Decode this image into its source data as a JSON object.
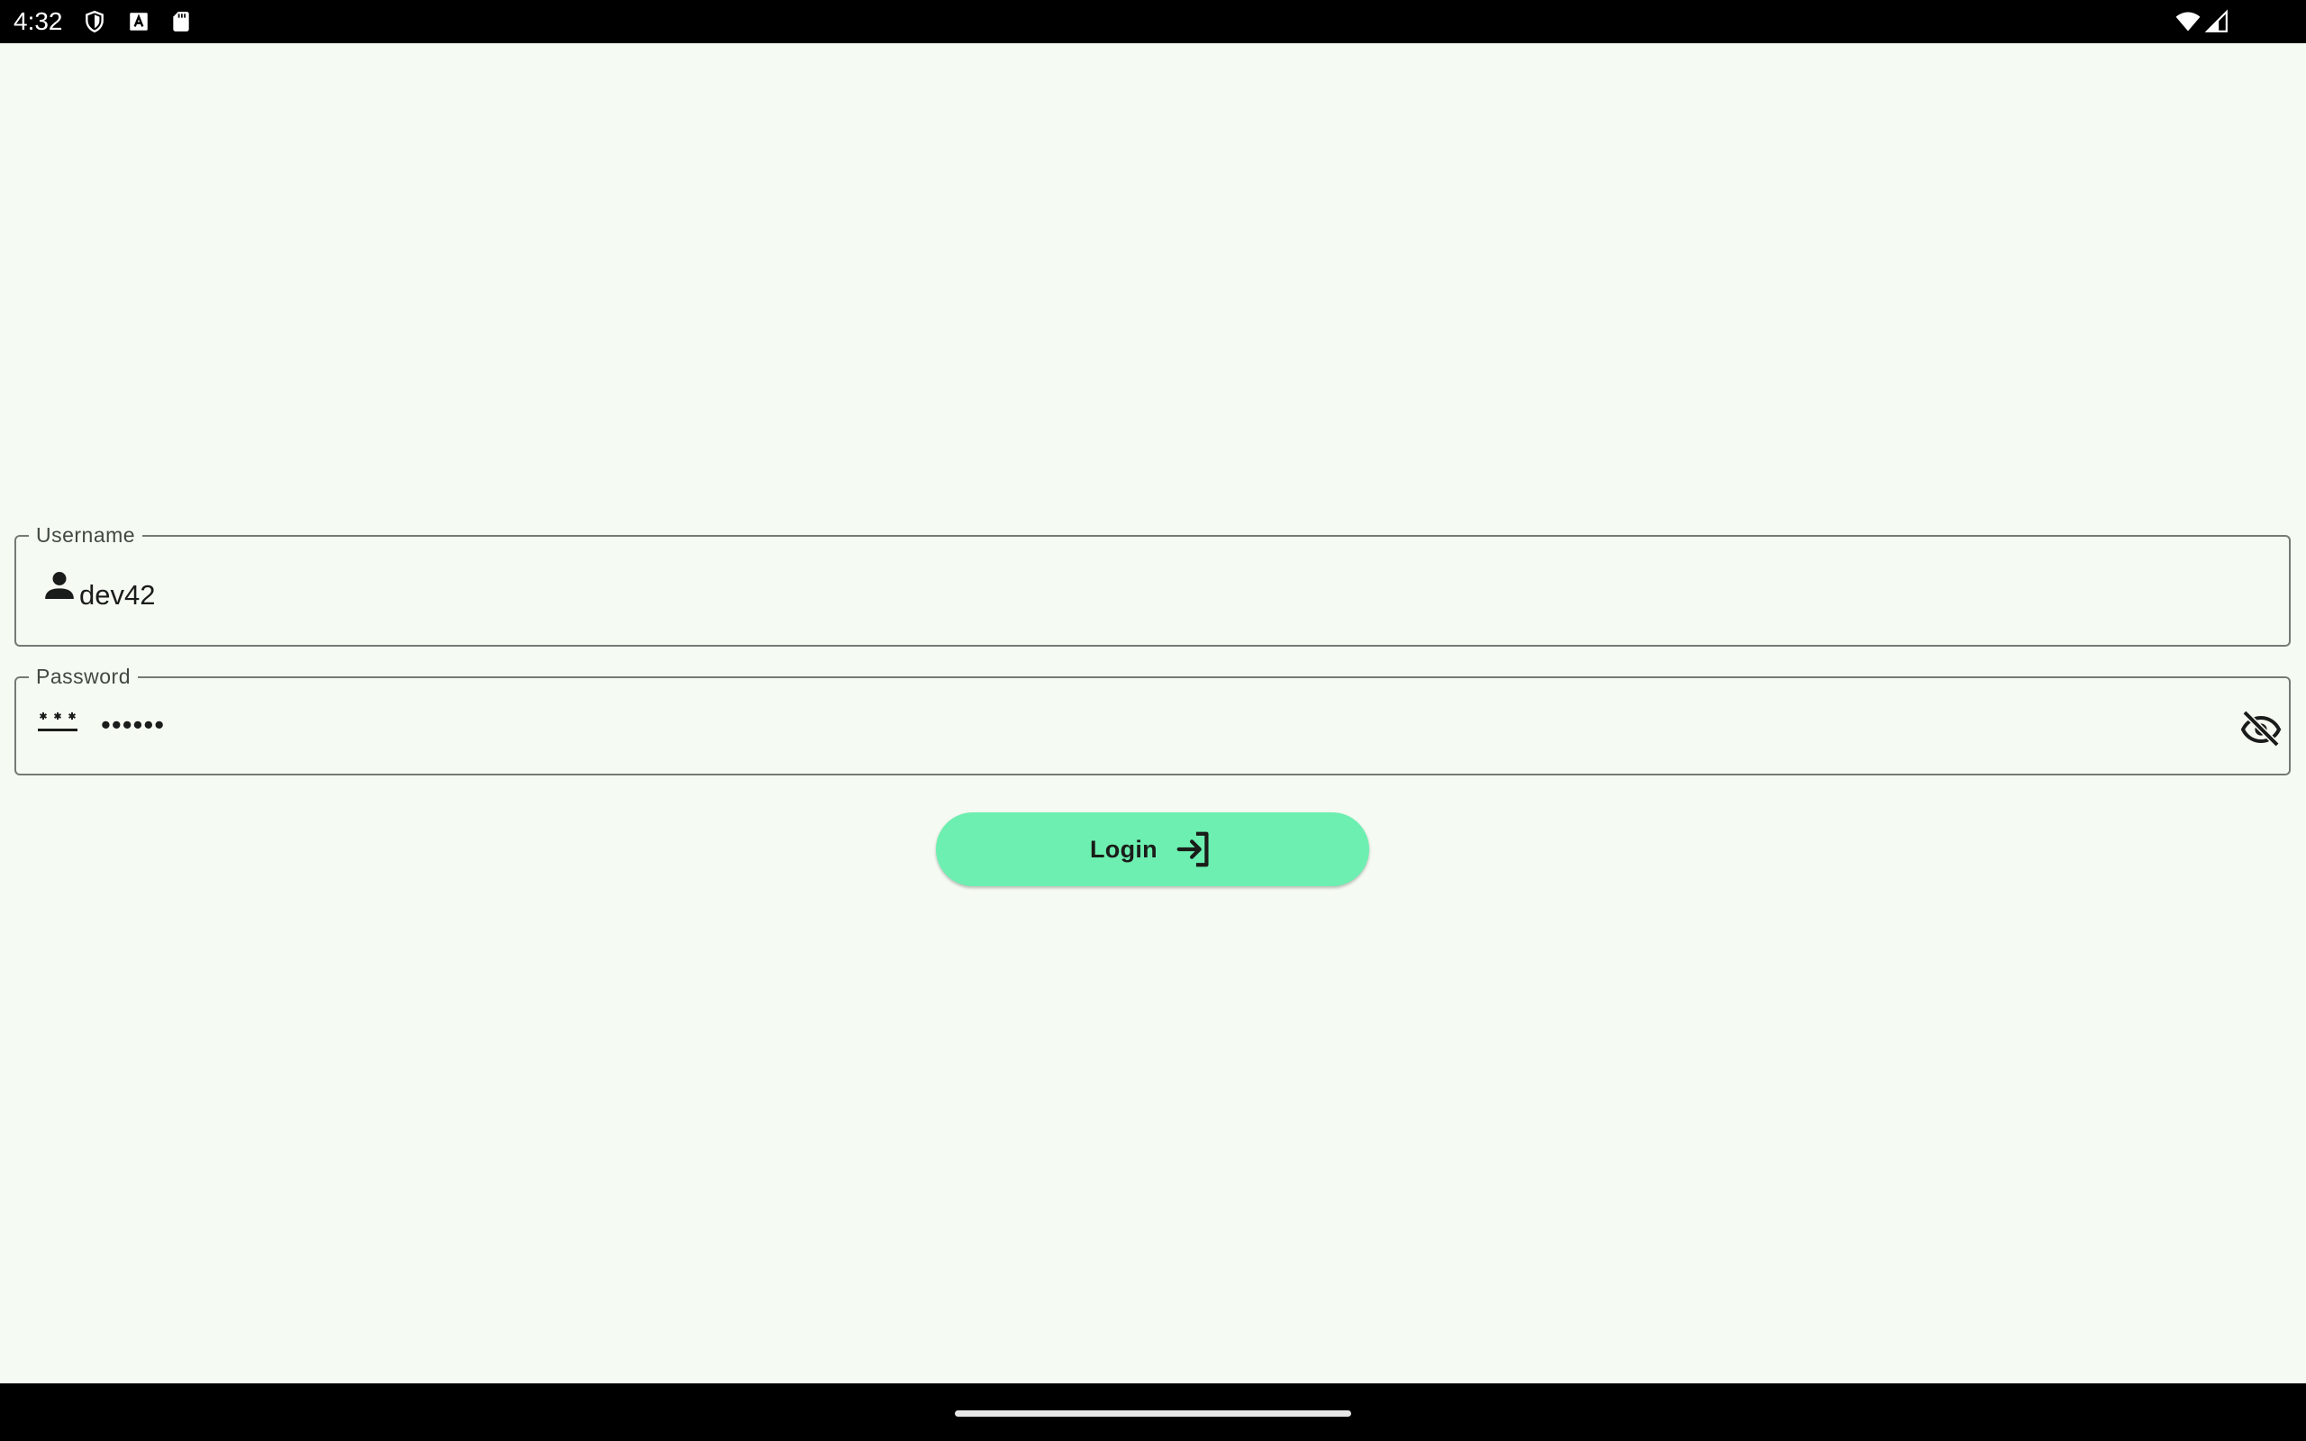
{
  "status_bar": {
    "time": "4:32",
    "left_icons": [
      "shield-icon",
      "font-icon",
      "sd-card-icon"
    ],
    "right_icons": [
      "wifi-icon",
      "cellular-signal-icon"
    ]
  },
  "form": {
    "username": {
      "label": "Username",
      "value": "dev42",
      "leading_icon": "person-icon"
    },
    "password": {
      "label": "Password",
      "value": "••••••",
      "leading_icon": "password-icon",
      "trailing_icon": "visibility-off-icon"
    },
    "login_button": {
      "label": "Login",
      "icon": "login-icon"
    }
  },
  "colors": {
    "background": "#f5faf2",
    "button": "#6cefb0",
    "outline": "#747a74",
    "bars": "#000000"
  }
}
